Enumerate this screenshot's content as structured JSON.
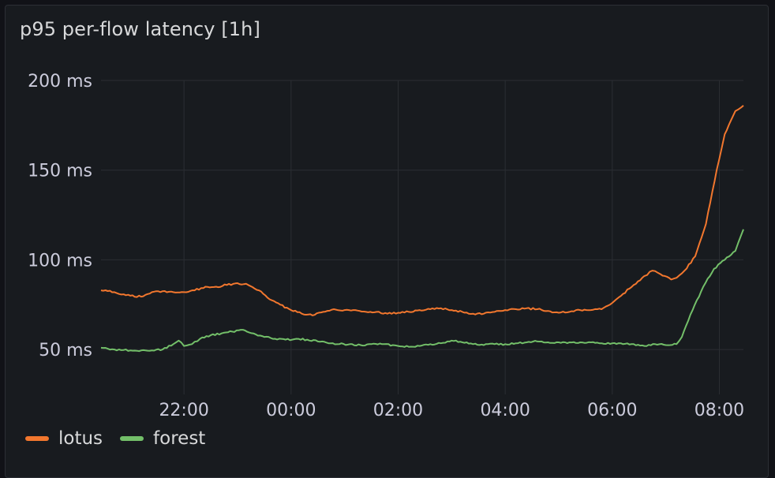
{
  "panel": {
    "title": "p95 per-flow latency [1h]"
  },
  "chart_data": {
    "type": "line",
    "ylim": [
      25,
      200
    ],
    "yticks": [
      {
        "value": 50,
        "label": "50 ms"
      },
      {
        "value": 100,
        "label": "100 ms"
      },
      {
        "value": 150,
        "label": "150 ms"
      },
      {
        "value": 200,
        "label": "200 ms"
      }
    ],
    "xlim": [
      20.45,
      8.45
    ],
    "xticks": [
      {
        "value": 22.0,
        "label": "22:00"
      },
      {
        "value": 24.0,
        "label": "00:00"
      },
      {
        "value": 26.0,
        "label": "02:00"
      },
      {
        "value": 28.0,
        "label": "04:00"
      },
      {
        "value": 30.0,
        "label": "06:00"
      },
      {
        "value": 32.0,
        "label": "08:00"
      }
    ],
    "grid": true,
    "legend_position": "bottom-left",
    "series": [
      {
        "name": "lotus",
        "color": "#f2772e",
        "points": [
          [
            20.45,
            83
          ],
          [
            20.7,
            82
          ],
          [
            21.0,
            80
          ],
          [
            21.2,
            79.5
          ],
          [
            21.4,
            82
          ],
          [
            21.6,
            82.5
          ],
          [
            21.8,
            82
          ],
          [
            22.0,
            82
          ],
          [
            22.2,
            83
          ],
          [
            22.4,
            85
          ],
          [
            22.6,
            85
          ],
          [
            22.8,
            86
          ],
          [
            23.0,
            87
          ],
          [
            23.2,
            86
          ],
          [
            23.4,
            83
          ],
          [
            23.6,
            78
          ],
          [
            23.8,
            75
          ],
          [
            24.0,
            72
          ],
          [
            24.2,
            70
          ],
          [
            24.4,
            69
          ],
          [
            24.6,
            71
          ],
          [
            24.8,
            72.5
          ],
          [
            25.0,
            72
          ],
          [
            25.2,
            72
          ],
          [
            25.4,
            71
          ],
          [
            25.6,
            71
          ],
          [
            25.8,
            70
          ],
          [
            26.0,
            70.5
          ],
          [
            26.2,
            71
          ],
          [
            26.4,
            72
          ],
          [
            26.6,
            72.5
          ],
          [
            26.8,
            73
          ],
          [
            27.0,
            72
          ],
          [
            27.2,
            71
          ],
          [
            27.4,
            70
          ],
          [
            27.6,
            70
          ],
          [
            27.8,
            71
          ],
          [
            28.0,
            72
          ],
          [
            28.2,
            72.5
          ],
          [
            28.4,
            73
          ],
          [
            28.6,
            72.5
          ],
          [
            28.8,
            71.5
          ],
          [
            29.0,
            70.5
          ],
          [
            29.2,
            71
          ],
          [
            29.4,
            72
          ],
          [
            29.6,
            72
          ],
          [
            29.8,
            72.5
          ],
          [
            30.0,
            76
          ],
          [
            30.2,
            81
          ],
          [
            30.4,
            86
          ],
          [
            30.6,
            91
          ],
          [
            30.75,
            94
          ],
          [
            30.9,
            92
          ],
          [
            31.1,
            89
          ],
          [
            31.2,
            90
          ],
          [
            31.35,
            94
          ],
          [
            31.55,
            102
          ],
          [
            31.75,
            120
          ],
          [
            31.95,
            150
          ],
          [
            32.1,
            170
          ],
          [
            32.3,
            183
          ],
          [
            32.45,
            186
          ]
        ]
      },
      {
        "name": "forest",
        "color": "#73bf69",
        "points": [
          [
            20.45,
            51
          ],
          [
            20.7,
            50
          ],
          [
            21.0,
            49.5
          ],
          [
            21.2,
            49.5
          ],
          [
            21.4,
            49.5
          ],
          [
            21.6,
            50
          ],
          [
            21.8,
            53
          ],
          [
            21.9,
            55
          ],
          [
            22.0,
            52
          ],
          [
            22.15,
            53
          ],
          [
            22.3,
            56
          ],
          [
            22.5,
            58
          ],
          [
            22.7,
            59
          ],
          [
            22.9,
            60
          ],
          [
            23.1,
            61
          ],
          [
            23.3,
            59
          ],
          [
            23.5,
            57
          ],
          [
            23.7,
            56
          ],
          [
            23.9,
            55.5
          ],
          [
            24.1,
            56
          ],
          [
            24.3,
            55.5
          ],
          [
            24.5,
            54.5
          ],
          [
            24.7,
            53.5
          ],
          [
            24.9,
            53
          ],
          [
            25.1,
            53
          ],
          [
            25.3,
            52.5
          ],
          [
            25.5,
            53
          ],
          [
            25.7,
            53
          ],
          [
            25.9,
            52.5
          ],
          [
            26.0,
            52
          ],
          [
            26.2,
            51.5
          ],
          [
            26.4,
            52
          ],
          [
            26.6,
            53
          ],
          [
            26.8,
            53.5
          ],
          [
            27.0,
            55
          ],
          [
            27.2,
            54
          ],
          [
            27.4,
            53
          ],
          [
            27.6,
            52.5
          ],
          [
            27.8,
            53
          ],
          [
            28.0,
            53
          ],
          [
            28.2,
            53.5
          ],
          [
            28.4,
            54
          ],
          [
            28.6,
            54.5
          ],
          [
            28.8,
            54
          ],
          [
            29.0,
            54
          ],
          [
            29.2,
            54
          ],
          [
            29.4,
            54
          ],
          [
            29.6,
            54
          ],
          [
            29.8,
            53.5
          ],
          [
            30.0,
            53.5
          ],
          [
            30.2,
            53
          ],
          [
            30.4,
            53
          ],
          [
            30.6,
            52
          ],
          [
            30.8,
            53
          ],
          [
            31.0,
            52.5
          ],
          [
            31.2,
            53
          ],
          [
            31.3,
            57
          ],
          [
            31.5,
            72
          ],
          [
            31.7,
            85
          ],
          [
            31.9,
            95
          ],
          [
            32.1,
            100
          ],
          [
            32.3,
            105
          ],
          [
            32.45,
            117
          ]
        ]
      }
    ]
  }
}
